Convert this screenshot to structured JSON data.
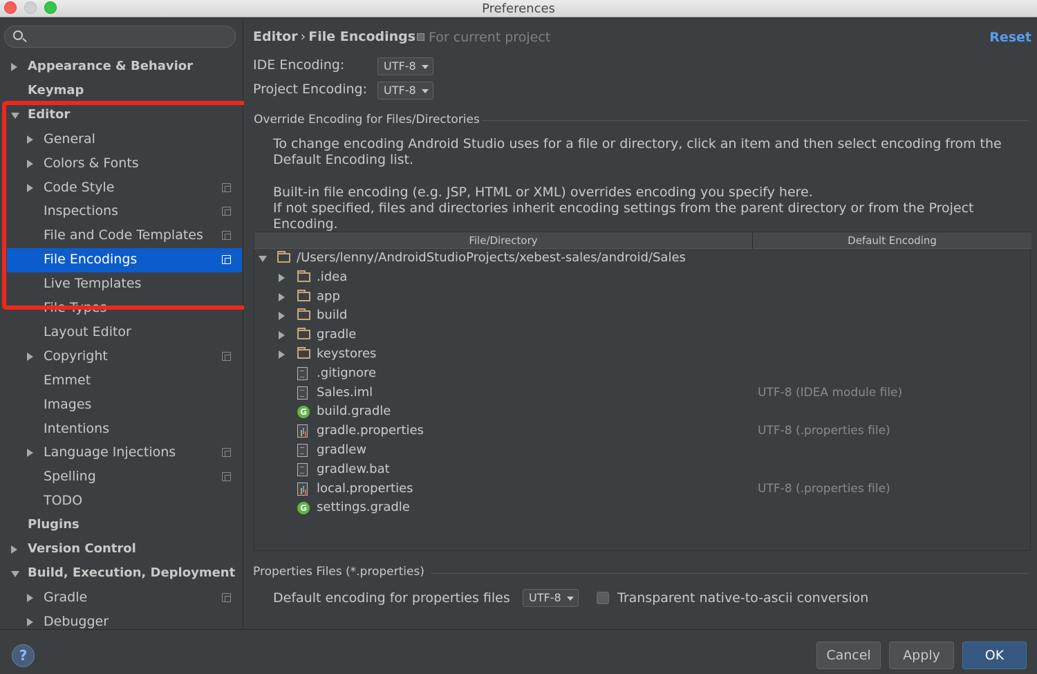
{
  "window": {
    "title": "Preferences"
  },
  "sidebar": {
    "search_placeholder": "",
    "items": [
      {
        "label": "Appearance & Behavior",
        "level": 0,
        "arrow": "right",
        "bold": true
      },
      {
        "label": "Keymap",
        "level": 0,
        "arrow": "none",
        "bold": true
      },
      {
        "label": "Editor",
        "level": 0,
        "arrow": "down",
        "bold": true
      },
      {
        "label": "General",
        "level": 1,
        "arrow": "right"
      },
      {
        "label": "Colors & Fonts",
        "level": 1,
        "arrow": "right"
      },
      {
        "label": "Code Style",
        "level": 1,
        "arrow": "right",
        "copy_icon": true
      },
      {
        "label": "Inspections",
        "level": 1,
        "arrow": "none",
        "copy_icon": true
      },
      {
        "label": "File and Code Templates",
        "level": 1,
        "arrow": "none",
        "copy_icon": true
      },
      {
        "label": "File Encodings",
        "level": 1,
        "arrow": "none",
        "copy_icon": true,
        "selected": true
      },
      {
        "label": "Live Templates",
        "level": 1,
        "arrow": "none"
      },
      {
        "label": "File Types",
        "level": 1,
        "arrow": "none"
      },
      {
        "label": "Layout Editor",
        "level": 1,
        "arrow": "none"
      },
      {
        "label": "Copyright",
        "level": 1,
        "arrow": "right",
        "copy_icon": true
      },
      {
        "label": "Emmet",
        "level": 1,
        "arrow": "none"
      },
      {
        "label": "Images",
        "level": 1,
        "arrow": "none"
      },
      {
        "label": "Intentions",
        "level": 1,
        "arrow": "none"
      },
      {
        "label": "Language Injections",
        "level": 1,
        "arrow": "right",
        "copy_icon": true
      },
      {
        "label": "Spelling",
        "level": 1,
        "arrow": "none",
        "copy_icon": true
      },
      {
        "label": "TODO",
        "level": 1,
        "arrow": "none"
      },
      {
        "label": "Plugins",
        "level": 0,
        "arrow": "none",
        "bold": true
      },
      {
        "label": "Version Control",
        "level": 0,
        "arrow": "right",
        "bold": true
      },
      {
        "label": "Build, Execution, Deployment",
        "level": 0,
        "arrow": "down",
        "bold": true
      },
      {
        "label": "Gradle",
        "level": 1,
        "arrow": "right",
        "copy_icon": true
      },
      {
        "label": "Debugger",
        "level": 1,
        "arrow": "right"
      }
    ]
  },
  "main": {
    "breadcrumb": {
      "parent": "Editor",
      "separator": "›",
      "current": "File Encodings"
    },
    "scope_hint": "For current project",
    "reset_label": "Reset",
    "ide_encoding": {
      "label": "IDE Encoding:",
      "value": "UTF-8"
    },
    "project_encoding": {
      "label": "Project Encoding:",
      "value": "UTF-8"
    },
    "override_section": {
      "title": "Override Encoding for Files/Directories",
      "desc1_line1": "To change encoding Android Studio uses for a file or directory, click an item and then select encoding from the",
      "desc1_line2": "Default Encoding list.",
      "desc2_line1": "Built-in file encoding (e.g. JSP, HTML or XML) overrides encoding you specify here.",
      "desc2_line2": "If not specified, files and directories inherit encoding settings from the parent directory or from the Project Encoding."
    },
    "table": {
      "columns": [
        "File/Directory",
        "Default Encoding"
      ],
      "rows": [
        {
          "name": "/Users/lenny/AndroidStudioProjects/xebest-sales/android/Sales",
          "icon": "folder-icon",
          "depth": 0,
          "arrow": "down",
          "encoding": ""
        },
        {
          "name": ".idea",
          "icon": "folder-icon",
          "depth": 1,
          "arrow": "right",
          "encoding": ""
        },
        {
          "name": "app",
          "icon": "folder-icon",
          "depth": 1,
          "arrow": "right",
          "encoding": ""
        },
        {
          "name": "build",
          "icon": "folder-icon",
          "depth": 1,
          "arrow": "right",
          "encoding": ""
        },
        {
          "name": "gradle",
          "icon": "folder-icon",
          "depth": 1,
          "arrow": "right",
          "encoding": ""
        },
        {
          "name": "keystores",
          "icon": "folder-icon",
          "depth": 1,
          "arrow": "right",
          "encoding": ""
        },
        {
          "name": ".gitignore",
          "icon": "text-file-icon",
          "depth": 1,
          "arrow": "none",
          "encoding": ""
        },
        {
          "name": "Sales.iml",
          "icon": "module-file-icon",
          "depth": 1,
          "arrow": "none",
          "encoding": "UTF-8 (IDEA module file)"
        },
        {
          "name": "build.gradle",
          "icon": "gradle-icon",
          "depth": 1,
          "arrow": "none",
          "encoding": ""
        },
        {
          "name": "gradle.properties",
          "icon": "properties-file-icon",
          "depth": 1,
          "arrow": "none",
          "encoding": "UTF-8 (.properties file)"
        },
        {
          "name": "gradlew",
          "icon": "text-file-icon",
          "depth": 1,
          "arrow": "none",
          "encoding": ""
        },
        {
          "name": "gradlew.bat",
          "icon": "text-file-icon",
          "depth": 1,
          "arrow": "none",
          "encoding": ""
        },
        {
          "name": "local.properties",
          "icon": "properties-file-icon",
          "depth": 1,
          "arrow": "none",
          "encoding": "UTF-8 (.properties file)"
        },
        {
          "name": "settings.gradle",
          "icon": "gradle-icon",
          "depth": 1,
          "arrow": "none",
          "encoding": ""
        }
      ]
    },
    "properties_section": {
      "title": "Properties Files (*.properties)",
      "default_label": "Default encoding for properties files",
      "default_value": "UTF-8",
      "transparent_label": "Transparent native-to-ascii conversion",
      "transparent_checked": false
    }
  },
  "footer": {
    "help_label": "?",
    "cancel_label": "Cancel",
    "apply_label": "Apply",
    "ok_label": "OK"
  },
  "colors": {
    "background": "#3c3f41",
    "selection": "#0d5ccc",
    "link": "#589df6",
    "highlight_box": "#f0281c",
    "default_button": "#365880"
  }
}
